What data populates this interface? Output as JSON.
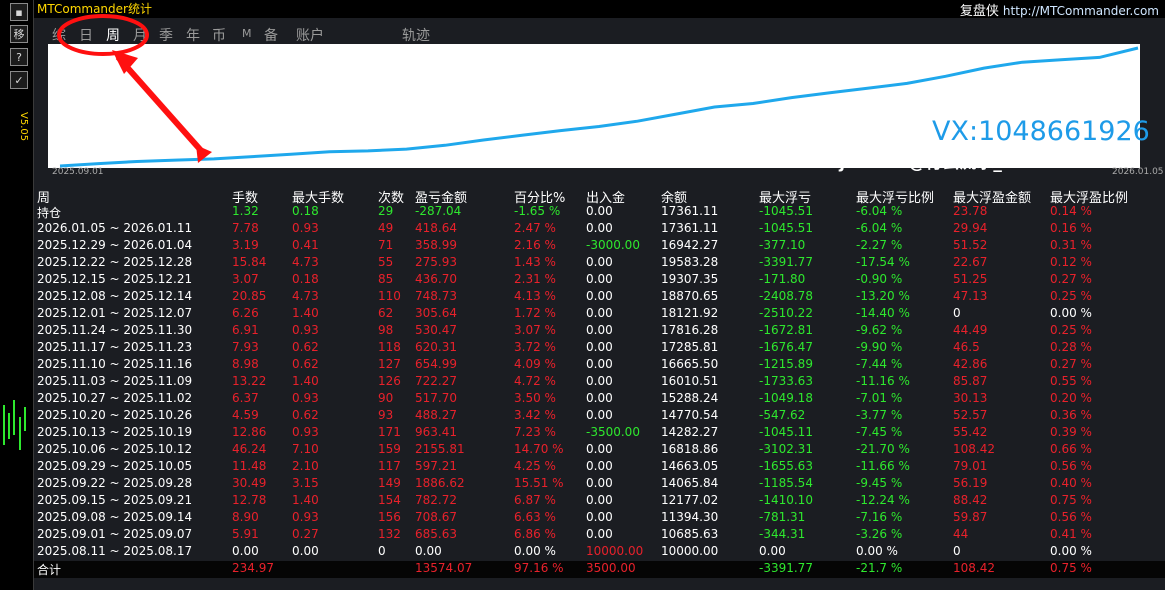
{
  "app_title": "MTCommander统计",
  "brand": {
    "name": "复盘侠",
    "url": "http://MTCommander.com"
  },
  "version": "V5.05",
  "side_buttons": [
    "移",
    "?",
    "✓"
  ],
  "tabs": [
    "综",
    "日",
    "周",
    "月",
    "季",
    "年",
    "币",
    "M",
    "备",
    "账户",
    "轨迹"
  ],
  "active_tab": "周",
  "chart": {
    "start_date": "2025.09.01",
    "end_date": "2026.01.05",
    "line_color": "#1fa8ec",
    "background": "#ffffff"
  },
  "chart_data": {
    "type": "line",
    "x_start": "2025.09.01",
    "x_end": "2026.01.05",
    "series": [
      {
        "values": [
          0,
          2,
          3.8,
          5,
          6,
          8,
          10,
          12,
          12.8,
          14.3,
          17.5,
          22,
          26,
          30,
          33.5,
          38,
          44,
          50,
          53,
          58,
          62,
          66,
          70,
          76,
          83,
          88,
          90,
          92,
          100
        ]
      }
    ],
    "ylim": [
      0,
      100
    ],
    "grid": false
  },
  "watermark": {
    "vx": "VX:1048661926",
    "site": "www.eazhijia.com@行云流水_3971"
  },
  "colors": {
    "green": "#2ee82e",
    "red": "#e8212b",
    "white": "#ffffff",
    "gray": "#d0d0d0"
  },
  "headers": [
    "周",
    "手数",
    "最大手数",
    "次数",
    "盈亏金额",
    "百分比%",
    "出入金",
    "余额",
    "最大浮亏",
    "最大浮亏比例",
    "最大浮盈金额",
    "最大浮盈比例"
  ],
  "position_row": {
    "label": "持仓",
    "values": [
      "1.32",
      "0.18",
      "29",
      "-287.04",
      "-1.65 %",
      "0.00",
      "17361.11",
      "-1045.51",
      "-6.04 %",
      "23.78",
      "0.14 %"
    ]
  },
  "rows": [
    [
      "2026.01.05 ~ 2026.01.11",
      "7.78",
      "0.93",
      "49",
      "418.64",
      "2.47 %",
      "0.00",
      "17361.11",
      "-1045.51",
      "-6.04 %",
      "29.94",
      "0.16 %"
    ],
    [
      "2025.12.29 ~ 2026.01.04",
      "3.19",
      "0.41",
      "71",
      "358.99",
      "2.16 %",
      "-3000.00",
      "16942.27",
      "-377.10",
      "-2.27 %",
      "51.52",
      "0.31 %"
    ],
    [
      "2025.12.22 ~ 2025.12.28",
      "15.84",
      "4.73",
      "55",
      "275.93",
      "1.43 %",
      "0.00",
      "19583.28",
      "-3391.77",
      "-17.54 %",
      "22.67",
      "0.12 %"
    ],
    [
      "2025.12.15 ~ 2025.12.21",
      "3.07",
      "0.18",
      "85",
      "436.70",
      "2.31 %",
      "0.00",
      "19307.35",
      "-171.80",
      "-0.90 %",
      "51.25",
      "0.27 %"
    ],
    [
      "2025.12.08 ~ 2025.12.14",
      "20.85",
      "4.73",
      "110",
      "748.73",
      "4.13 %",
      "0.00",
      "18870.65",
      "-2408.78",
      "-13.20 %",
      "47.13",
      "0.25 %"
    ],
    [
      "2025.12.01 ~ 2025.12.07",
      "6.26",
      "1.40",
      "62",
      "305.64",
      "1.72 %",
      "0.00",
      "18121.92",
      "-2510.22",
      "-14.40 %",
      "0",
      "0.00 %"
    ],
    [
      "2025.11.24 ~ 2025.11.30",
      "6.91",
      "0.93",
      "98",
      "530.47",
      "3.07 %",
      "0.00",
      "17816.28",
      "-1672.81",
      "-9.62 %",
      "44.49",
      "0.25 %"
    ],
    [
      "2025.11.17 ~ 2025.11.23",
      "7.93",
      "0.62",
      "118",
      "620.31",
      "3.72 %",
      "0.00",
      "17285.81",
      "-1676.47",
      "-9.90 %",
      "46.5",
      "0.28 %"
    ],
    [
      "2025.11.10 ~ 2025.11.16",
      "8.98",
      "0.62",
      "127",
      "654.99",
      "4.09 %",
      "0.00",
      "16665.50",
      "-1215.89",
      "-7.44 %",
      "42.86",
      "0.27 %"
    ],
    [
      "2025.11.03 ~ 2025.11.09",
      "13.22",
      "1.40",
      "126",
      "722.27",
      "4.72 %",
      "0.00",
      "16010.51",
      "-1733.63",
      "-11.16 %",
      "85.87",
      "0.55 %"
    ],
    [
      "2025.10.27 ~ 2025.11.02",
      "6.37",
      "0.93",
      "90",
      "517.70",
      "3.50 %",
      "0.00",
      "15288.24",
      "-1049.18",
      "-7.01 %",
      "30.13",
      "0.20 %"
    ],
    [
      "2025.10.20 ~ 2025.10.26",
      "4.59",
      "0.62",
      "93",
      "488.27",
      "3.42 %",
      "0.00",
      "14770.54",
      "-547.62",
      "-3.77 %",
      "52.57",
      "0.36 %"
    ],
    [
      "2025.10.13 ~ 2025.10.19",
      "12.86",
      "0.93",
      "171",
      "963.41",
      "7.23 %",
      "-3500.00",
      "14282.27",
      "-1045.11",
      "-7.45 %",
      "55.42",
      "0.39 %"
    ],
    [
      "2025.10.06 ~ 2025.10.12",
      "46.24",
      "7.10",
      "159",
      "2155.81",
      "14.70 %",
      "0.00",
      "16818.86",
      "-3102.31",
      "-21.70 %",
      "108.42",
      "0.66 %"
    ],
    [
      "2025.09.29 ~ 2025.10.05",
      "11.48",
      "2.10",
      "117",
      "597.21",
      "4.25 %",
      "0.00",
      "14663.05",
      "-1655.63",
      "-11.66 %",
      "79.01",
      "0.56 %"
    ],
    [
      "2025.09.22 ~ 2025.09.28",
      "30.49",
      "3.15",
      "149",
      "1886.62",
      "15.51 %",
      "0.00",
      "14065.84",
      "-1185.54",
      "-9.45 %",
      "56.19",
      "0.40 %"
    ],
    [
      "2025.09.15 ~ 2025.09.21",
      "12.78",
      "1.40",
      "154",
      "782.72",
      "6.87 %",
      "0.00",
      "12177.02",
      "-1410.10",
      "-12.24 %",
      "88.42",
      "0.75 %"
    ],
    [
      "2025.09.08 ~ 2025.09.14",
      "8.90",
      "0.93",
      "156",
      "708.67",
      "6.63 %",
      "0.00",
      "11394.30",
      "-781.31",
      "-7.16 %",
      "59.87",
      "0.56 %"
    ],
    [
      "2025.09.01 ~ 2025.09.07",
      "5.91",
      "0.27",
      "132",
      "685.63",
      "6.86 %",
      "0.00",
      "10685.63",
      "-344.31",
      "-3.26 %",
      "44",
      "0.41 %"
    ],
    [
      "2025.08.11 ~ 2025.08.17",
      "0.00",
      "0.00",
      "0",
      "0.00",
      "0.00 %",
      "10000.00",
      "10000.00",
      "0.00",
      "0.00 %",
      "0",
      "0.00 %"
    ]
  ],
  "total_row": {
    "label": "合计",
    "values": [
      "234.97",
      "",
      "",
      "13574.07",
      "97.16 %",
      "3500.00",
      "",
      "-3391.77",
      "-21.7 %",
      "108.42",
      "0.75 %"
    ]
  }
}
